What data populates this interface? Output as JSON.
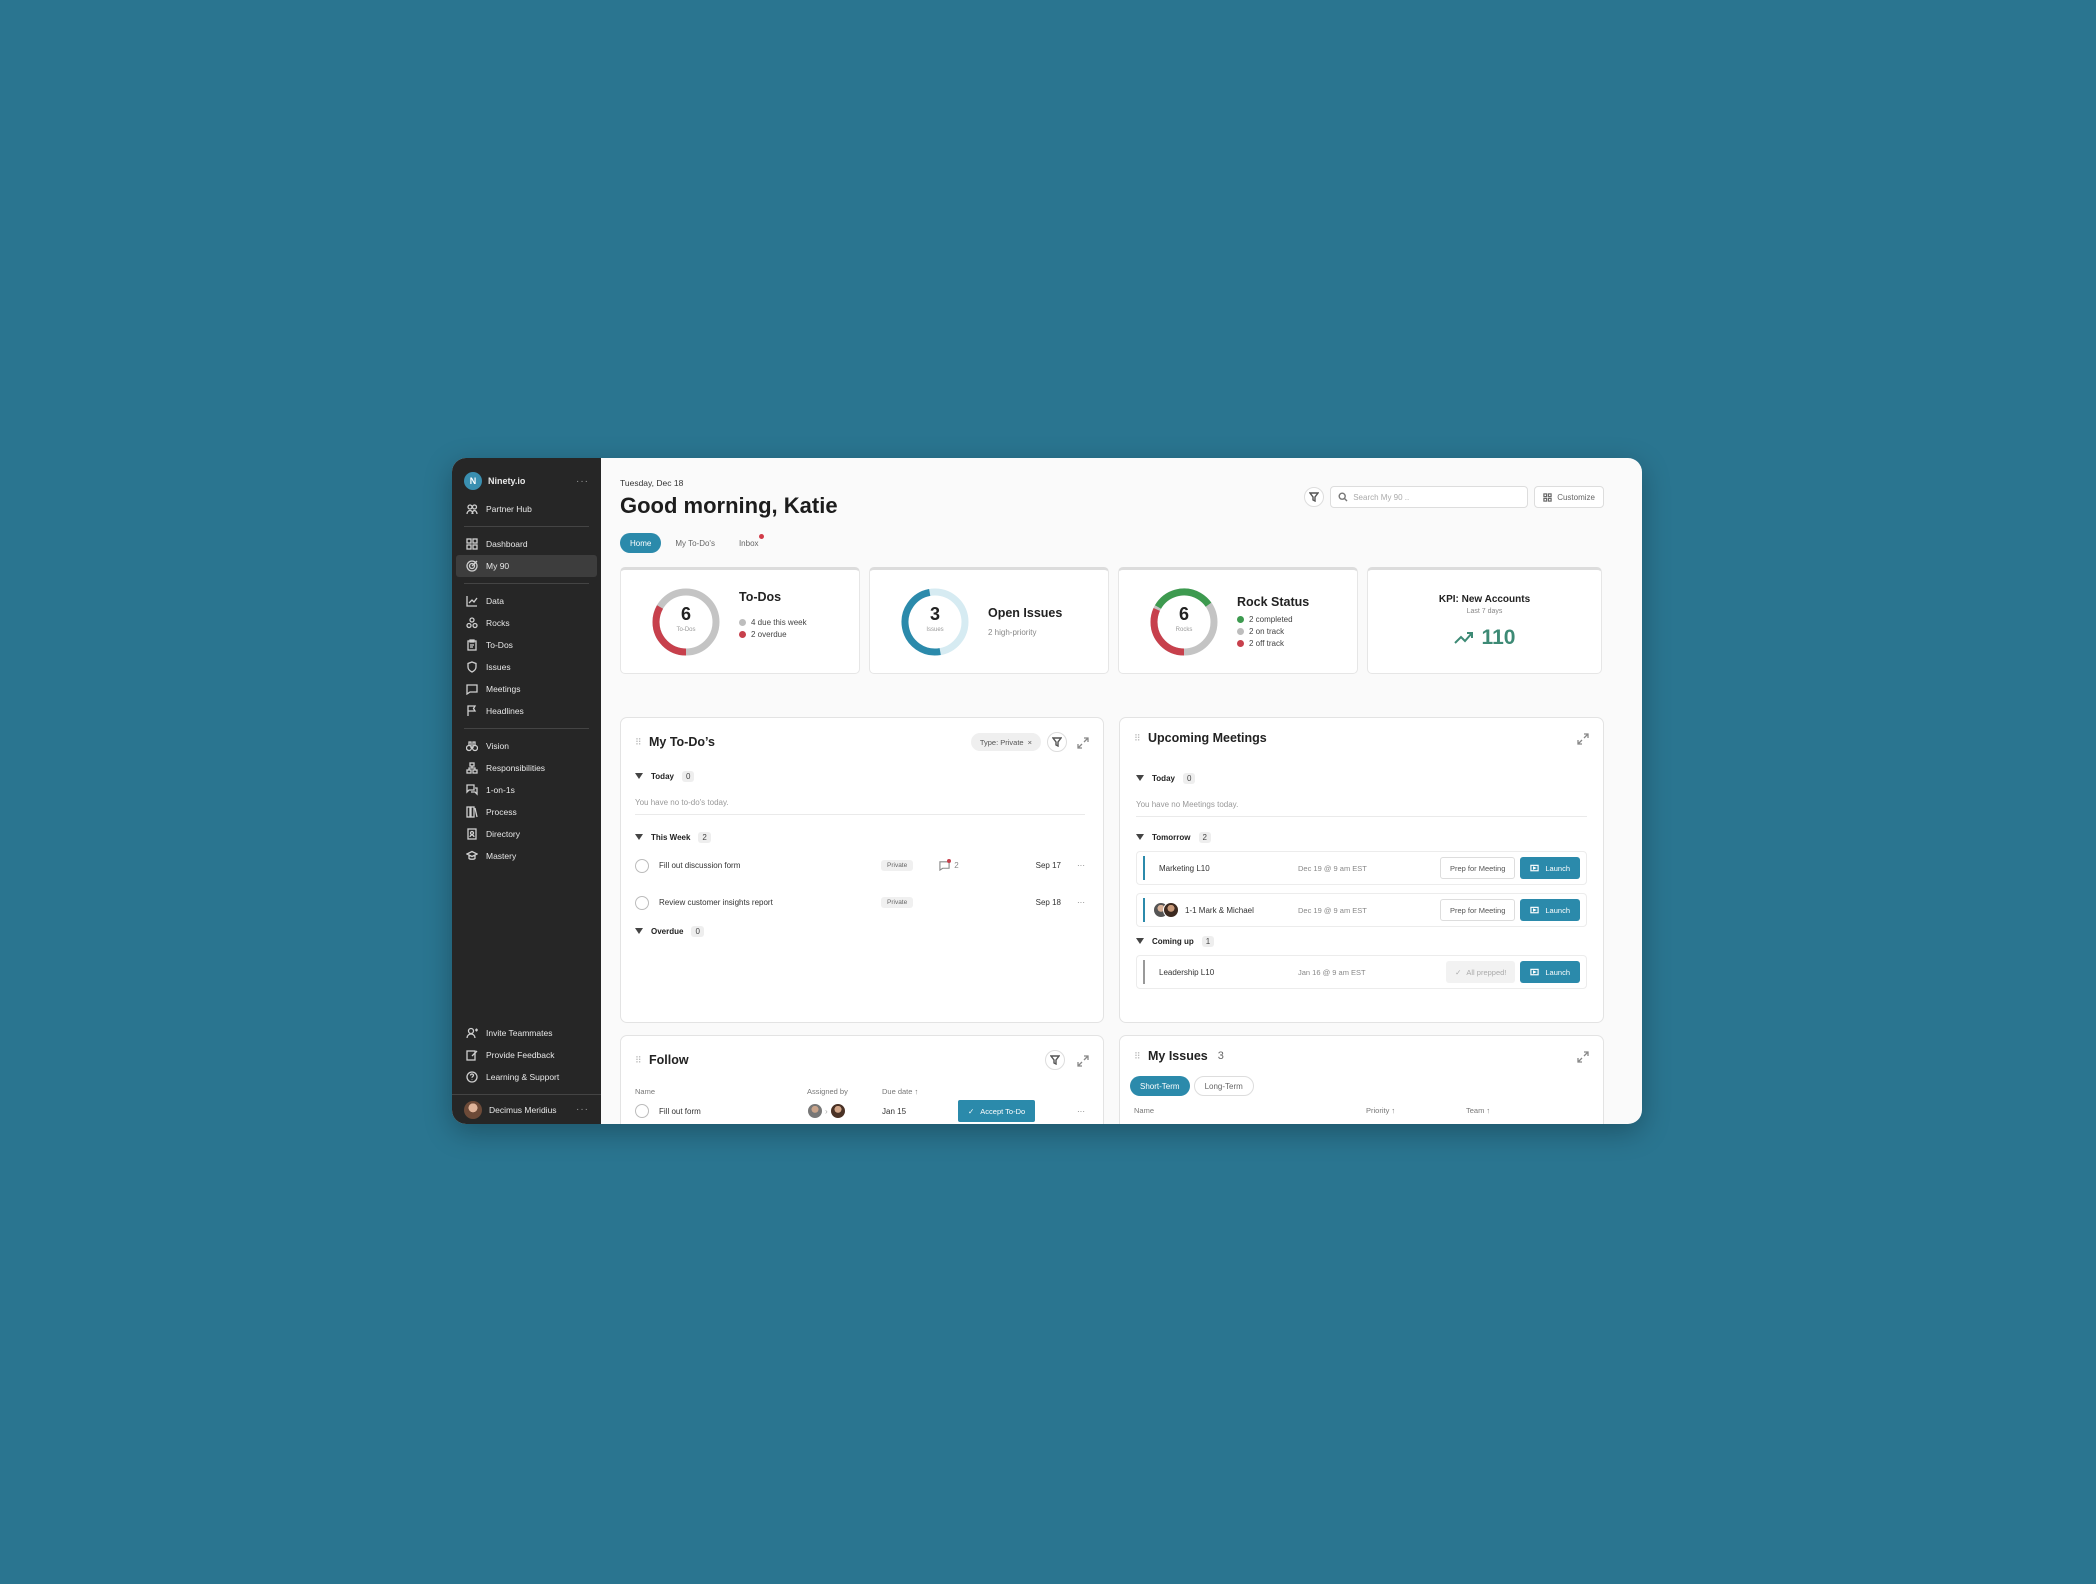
{
  "brand": {
    "name": "Ninety.io"
  },
  "sidebar": {
    "partner_hub": "Partner Hub",
    "group1": [
      "Dashboard",
      "My 90"
    ],
    "group2": [
      "Data",
      "Rocks",
      "To-Dos",
      "Issues",
      "Meetings",
      "Headlines"
    ],
    "group3": [
      "Vision",
      "Responsibilities",
      "1-on-1s",
      "Process",
      "Directory",
      "Mastery"
    ],
    "bottom": [
      "Invite Teammates",
      "Provide Feedback",
      "Learning & Support"
    ],
    "user": "Decimus Meridius"
  },
  "header": {
    "date": "Tuesday, Dec 18",
    "greeting": "Good morning, Katie",
    "search_placeholder": "Search My 90 ..",
    "customize": "Customize",
    "tabs": [
      "Home",
      "My To-Do's",
      "Inbox"
    ]
  },
  "stats": {
    "todos": {
      "num": "6",
      "sub": "To-Dos",
      "title": "To-Dos",
      "legend": [
        "4 due this week",
        "2 overdue"
      ]
    },
    "issues": {
      "num": "3",
      "sub": "Issues",
      "title": "Open Issues",
      "desc": "2 high-priority"
    },
    "rocks": {
      "num": "6",
      "sub": "Rocks",
      "title": "Rock Status",
      "legend": [
        "2 completed",
        "2 on track",
        "2 off track"
      ]
    },
    "kpi": {
      "title": "KPI: New Accounts",
      "sub": "Last 7 days",
      "value": "110"
    }
  },
  "colors": {
    "accent": "#2b8aab",
    "green": "#3d9a4f",
    "red": "#c7404c",
    "grey": "#bdbdbd",
    "kpi": "#3d8a75"
  },
  "mytodos": {
    "title": "My To-Do’s",
    "filter_chip": "Type: Private",
    "groups": {
      "today": "Today",
      "today_count": "0",
      "today_empty": "You have no to-do's today.",
      "week": "This Week",
      "week_count": "2",
      "overdue": "Overdue",
      "overdue_count": "0"
    },
    "items": [
      {
        "title": "Fill out discussion form",
        "tag": "Private",
        "comments": "2",
        "due": "Sep 17"
      },
      {
        "title": "Review customer insights report",
        "tag": "Private",
        "due": "Sep 18"
      }
    ]
  },
  "meetings": {
    "title": "Upcoming Meetings",
    "today": "Today",
    "today_count": "0",
    "today_empty": "You have no Meetings today.",
    "tomorrow": "Tomorrow",
    "tomorrow_count": "2",
    "coming": "Coming up",
    "coming_count": "1",
    "rows": [
      {
        "name": "Marketing L10",
        "time": "Dec 19 @ 9 am EST",
        "prep": "Prep for Meeting",
        "launch": "Launch"
      },
      {
        "name": "1-1 Mark & Michael",
        "time": "Dec 19 @ 9 am EST",
        "prep": "Prep for Meeting",
        "launch": "Launch"
      },
      {
        "name": "Leadership L10",
        "time": "Jan 16 @ 9 am EST",
        "prep": "All prepped!",
        "launch": "Launch"
      }
    ]
  },
  "follow": {
    "title": "Follow",
    "cols": [
      "Name",
      "Assigned by",
      "Due date"
    ],
    "row": {
      "name": "Fill out form",
      "due": "Jan 15",
      "action": "Accept To-Do"
    }
  },
  "issues": {
    "title": "My Issues",
    "count": "3",
    "tabs": [
      "Short-Term",
      "Long-Term"
    ],
    "cols": [
      "Name",
      "Priority",
      "Team"
    ]
  }
}
